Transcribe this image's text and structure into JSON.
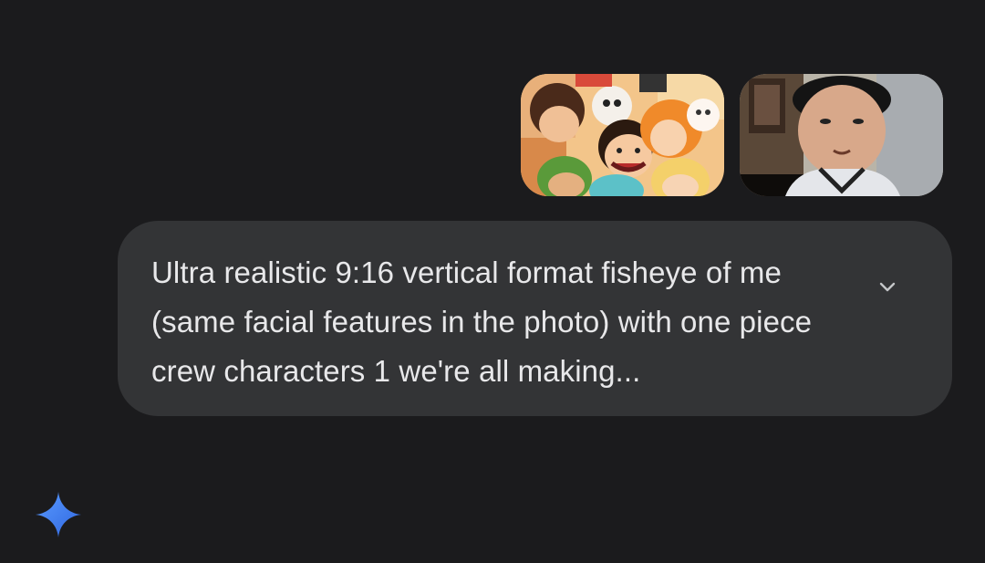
{
  "attachments": [
    {
      "name": "anime-crew-image",
      "alt": ""
    },
    {
      "name": "selfie-photo",
      "alt": ""
    }
  ],
  "prompt": {
    "text": "Ultra realistic 9:16 vertical format fisheye of me (same facial features in the photo) with one piece crew characters 1 we're all making..."
  },
  "icons": {
    "expand": "chevron-down-icon",
    "assistant": "gemini-sparkle-icon"
  },
  "colors": {
    "background": "#1b1b1d",
    "bubble": "#333436",
    "text": "#e8e8ea",
    "sparkle_start": "#4f8ef7",
    "sparkle_end": "#2e6ae6"
  }
}
